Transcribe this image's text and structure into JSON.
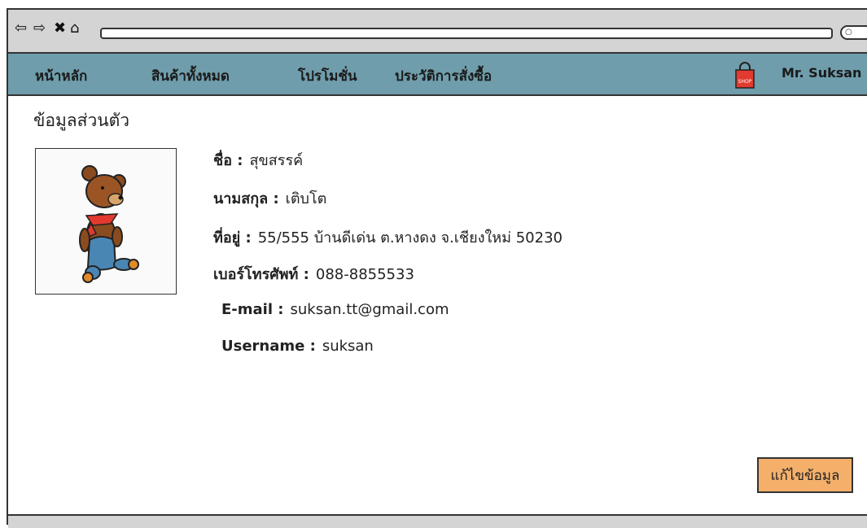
{
  "browser": {
    "back_icon": "back-arrow-icon",
    "forward_icon": "forward-arrow-icon",
    "close_icon": "close-icon",
    "home_icon": "home-icon",
    "search_icon": "search-icon"
  },
  "nav": {
    "items": [
      {
        "label": "หน้าหลัก"
      },
      {
        "label": "สินค้าทั้งหมด"
      },
      {
        "label": "โปรโมชั่น"
      },
      {
        "label": "ประวัติการสั่งซื้อ"
      }
    ],
    "cart_text": "SHOP",
    "user_name": "Mr. Suksan",
    "bg_color": "#6f9dab"
  },
  "profile": {
    "title": "ข้อมูลส่วนตัว",
    "avatar_icon": "teddy-bear-icon",
    "fields": [
      {
        "label": "ชื่อ :",
        "value": "สุขสรรค์"
      },
      {
        "label": "นามสกุล :",
        "value": "เติบโต"
      },
      {
        "label": "ที่อยู่ :",
        "value": "55/555 บ้านดีเด่น ต.หางดง จ.เชียงใหม่ 50230"
      },
      {
        "label": "เบอร์โทรศัพท์ :",
        "value": "088-8855533"
      },
      {
        "label": "E-mail :",
        "value": "suksan.tt@gmail.com"
      },
      {
        "label": "Username :",
        "value": "suksan"
      }
    ],
    "edit_button": "แก้ไขข้อมูล",
    "edit_button_color": "#f4b06b"
  }
}
